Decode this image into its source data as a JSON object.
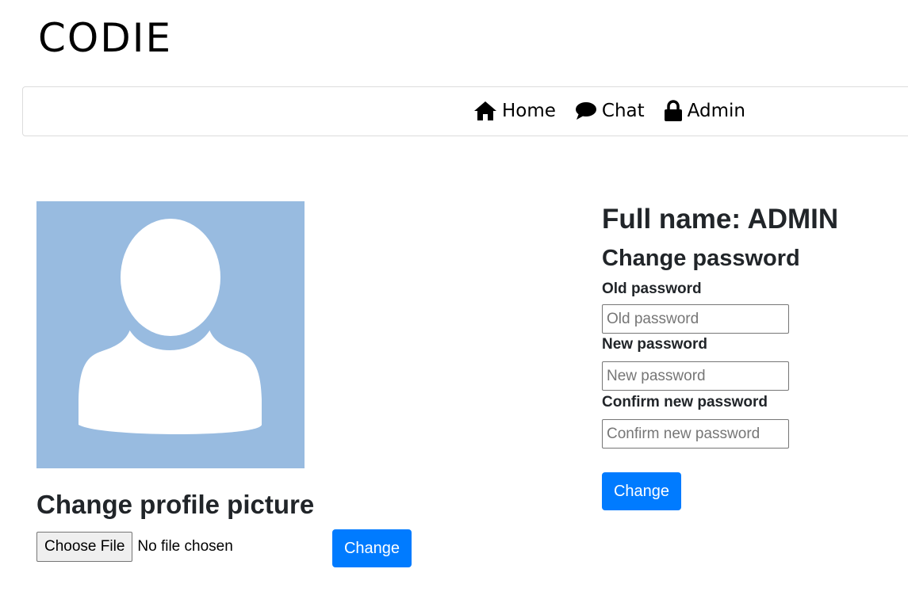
{
  "brand": {
    "title": "CODIE"
  },
  "nav": {
    "items": [
      {
        "label": "Home",
        "icon": "home-icon"
      },
      {
        "label": "Chat",
        "icon": "chat-bubble-icon"
      },
      {
        "label": "Admin",
        "icon": "lock-icon"
      }
    ]
  },
  "profile": {
    "full_name": "Full name: ADMIN",
    "avatar_color": "#98bbe0"
  },
  "picture": {
    "heading": "Change profile picture",
    "choose_file_label": "Choose File",
    "no_file_text": "No file chosen",
    "submit_label": "Change"
  },
  "password": {
    "heading": "Change password",
    "old_label": "Old password",
    "old_placeholder": "Old password",
    "new_label": "New password",
    "new_placeholder": "New password",
    "confirm_label": "Confirm new password",
    "confirm_placeholder": "Confirm new password",
    "submit_label": "Change"
  },
  "colors": {
    "primary": "#007bff",
    "text": "#212529"
  }
}
